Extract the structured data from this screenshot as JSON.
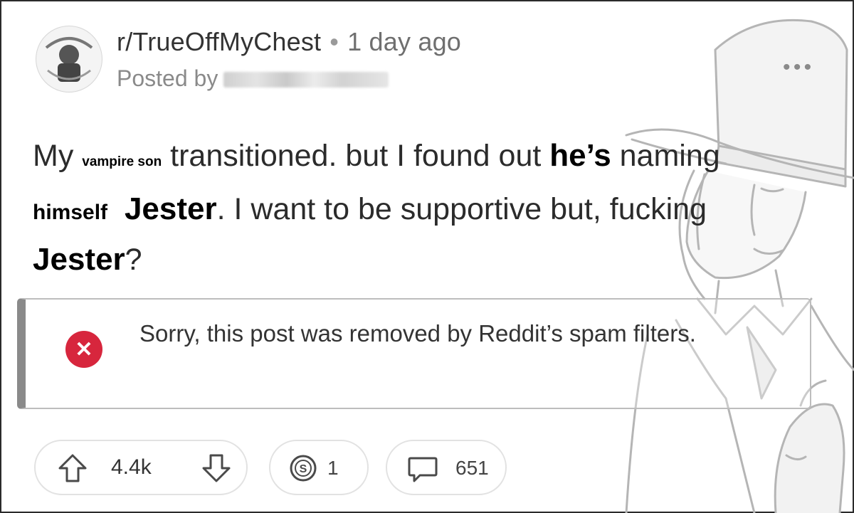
{
  "post": {
    "subreddit": "r/TrueOffMyChest",
    "separator": "•",
    "time": "1 day ago",
    "posted_by_label": "Posted by",
    "more_icon": "more-options-icon"
  },
  "title": {
    "part1": "My ",
    "overlay_subject": "vampire son",
    "part2": " transitioned. but I found out ",
    "overlay_pronoun": "he’s",
    "part3": " naming ",
    "overlay_reflexive": "himself",
    "overlay_name1": "Jester",
    "part4": ". I want to be supportive but, fucking ",
    "overlay_name2": "Jester",
    "part5": "?"
  },
  "notice": {
    "icon": "error-x-icon",
    "text": "Sorry, this post was removed by Reddit’s spam filters."
  },
  "actions": {
    "votes": "4.4k",
    "award_count": "1",
    "comment_count": "651"
  },
  "colors": {
    "error_red": "#d7263d",
    "notice_bar": "#8a8a8a",
    "text": "#1c1c1c"
  }
}
